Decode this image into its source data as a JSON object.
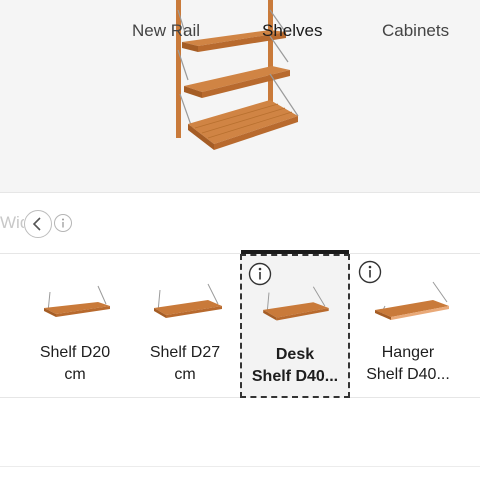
{
  "preview": {
    "product": "wall shelving unit with three wooden shelves on a rail"
  },
  "tabs": {
    "faded_prev": "Wid",
    "items": [
      {
        "label": "New Rail",
        "active": false
      },
      {
        "label": "Shelves",
        "active": true
      },
      {
        "label": "Cabinets",
        "active": false
      }
    ]
  },
  "products": [
    {
      "label_line1": "Shelf D20",
      "label_line2": "cm",
      "selected": false,
      "has_info": false
    },
    {
      "label_line1": "Shelf D27",
      "label_line2": "cm",
      "selected": false,
      "has_info": false
    },
    {
      "label_line1": "Desk",
      "label_line2": "Shelf D40...",
      "selected": true,
      "has_info": true
    },
    {
      "label_line1": "Hanger",
      "label_line2": "Shelf D40...",
      "selected": false,
      "has_info": true
    }
  ],
  "colors": {
    "wood": "#c97a3a",
    "wood_dark": "#a55d25",
    "metal": "#9a9a9a",
    "accent": "#1a1a1a"
  }
}
